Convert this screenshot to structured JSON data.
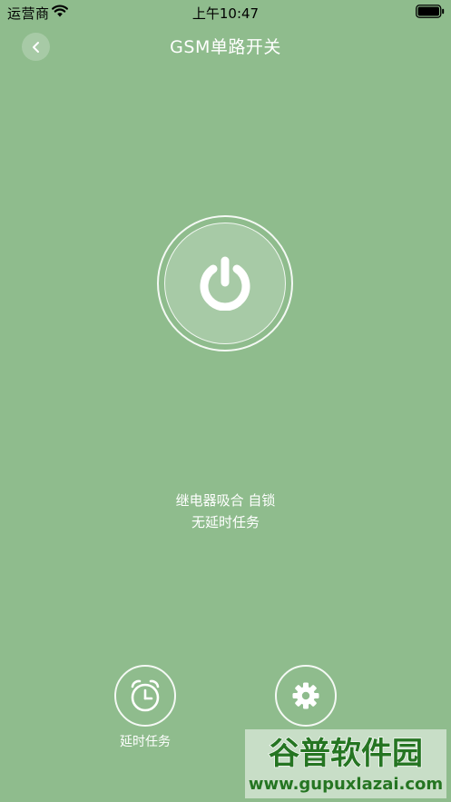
{
  "status_bar": {
    "carrier": "运营商",
    "time": "上午10:47"
  },
  "header": {
    "title": "GSM单路开关"
  },
  "relay_status": {
    "line1": "继电器吸合 自锁",
    "line2": "无延时任务"
  },
  "bottom_actions": {
    "delay_task_label": "延时任务"
  },
  "watermark": {
    "brand": "谷普软件园",
    "url": "www.gupuxlazai.com"
  },
  "colors": {
    "background": "#8fbc8d",
    "foreground": "#ffffff"
  }
}
